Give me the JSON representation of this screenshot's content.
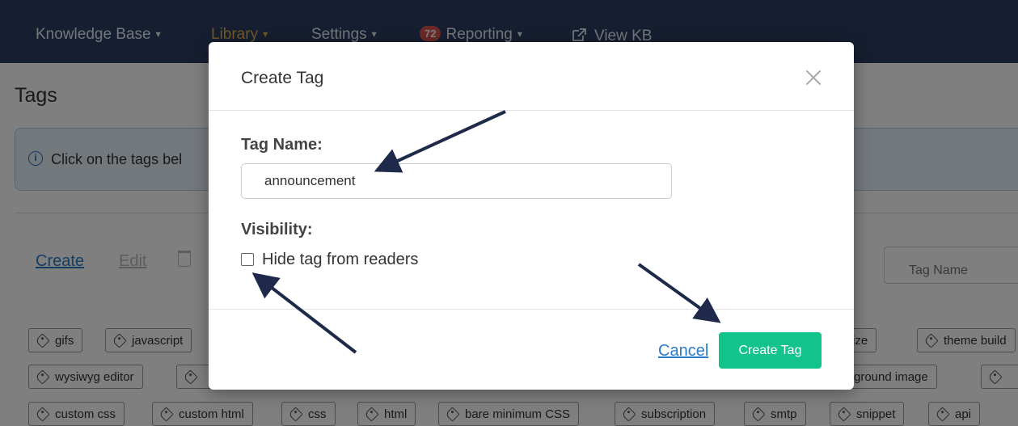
{
  "nav": {
    "items": [
      {
        "label": "Knowledge Base",
        "caret": "▾"
      },
      {
        "label": "Library",
        "caret": "▾"
      },
      {
        "label": "Settings",
        "caret": "▾"
      },
      {
        "label": "Reporting",
        "caret": "▾",
        "badge": "72"
      },
      {
        "label": "View KB",
        "icon": "external-link-icon"
      }
    ]
  },
  "page": {
    "title": "Tags",
    "info_text": "Click on the tags bel"
  },
  "toolbar": {
    "create_label": "Create",
    "edit_label": "Edit",
    "search_placeholder": "Tag Name"
  },
  "tags": {
    "row1": [
      "gifs",
      "javascript",
      "tomize",
      "theme build"
    ],
    "row2": [
      "wysiwyg editor",
      "ckground image"
    ],
    "row3": [
      "custom css",
      "custom html",
      "css",
      "html",
      "bare minimum CSS",
      "subscription",
      "smtp",
      "snippet",
      "api"
    ]
  },
  "modal": {
    "title": "Create Tag",
    "name_label": "Tag Name:",
    "name_value": "announcement",
    "visibility_label": "Visibility:",
    "hide_label": "Hide tag from readers",
    "hide_checked": false,
    "cancel_label": "Cancel",
    "submit_label": "Create Tag"
  },
  "colors": {
    "nav_bg": "#2c3e63",
    "nav_active": "#e3b44a",
    "accent_green": "#12c48b",
    "link_blue": "#2a7bc7",
    "arrow": "#1f2a4a"
  }
}
